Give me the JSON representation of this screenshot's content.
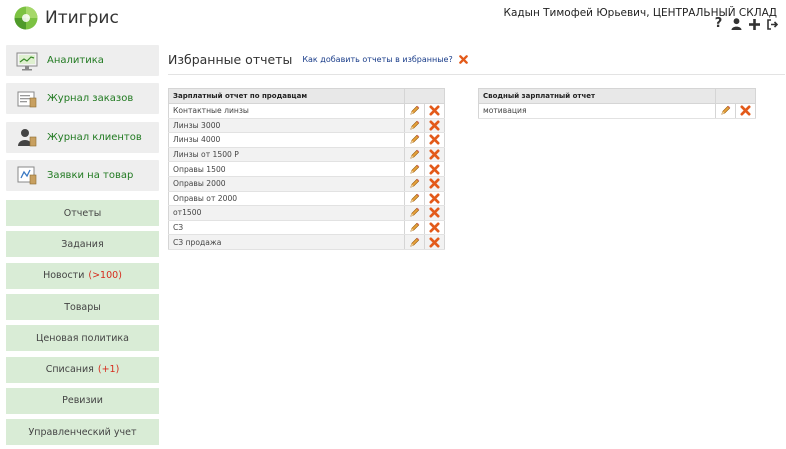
{
  "app": {
    "title": "Итигрис",
    "brand_color": "#6db33f"
  },
  "header": {
    "user": "Кадын Тимофей Юрьевич, ЦЕНТРАЛЬНЫЙ СКЛАД",
    "icons": [
      "help-icon",
      "user-icon",
      "add-icon",
      "logout-icon"
    ]
  },
  "sidebar": {
    "big_items": [
      {
        "label": "Аналитика",
        "icon": "analytics-icon"
      },
      {
        "label": "Журнал заказов",
        "icon": "orders-journal-icon"
      },
      {
        "label": "Журнал клиентов",
        "icon": "clients-journal-icon"
      },
      {
        "label": "Заявки на товар",
        "icon": "product-requests-icon"
      }
    ],
    "small_items": [
      {
        "label": "Отчеты",
        "badge": ""
      },
      {
        "label": "Задания",
        "badge": ""
      },
      {
        "label": "Новости",
        "badge": "(>100)"
      },
      {
        "label": "Товары",
        "badge": ""
      },
      {
        "label": "Ценовая политика",
        "badge": ""
      },
      {
        "label": "Списания",
        "badge": "(+1)"
      },
      {
        "label": "Ревизии",
        "badge": ""
      },
      {
        "label": "Управленческий учет",
        "badge": ""
      }
    ],
    "accent_color": "#217a21",
    "item_bg": "#d9ecd6",
    "badge_color": "#d62b1c"
  },
  "main": {
    "title": "Избранные отчеты",
    "help_link": "Как добавить отчеты в избранные?",
    "tables": [
      {
        "header": "Зарплатный отчет по продавцам",
        "rows": [
          "Контактные линзы",
          "Линзы 3000",
          "Линзы 4000",
          "Линзы от 1500 Р",
          "Оправы 1500",
          "Оправы 2000",
          "Оправы от 2000",
          "от1500",
          "СЗ",
          "СЗ продажа"
        ]
      },
      {
        "header": "Сводный зарплатный отчет",
        "rows": [
          "мотивация"
        ]
      }
    ],
    "row_icons": {
      "edit": "pencil-icon",
      "delete": "delete-icon"
    }
  }
}
